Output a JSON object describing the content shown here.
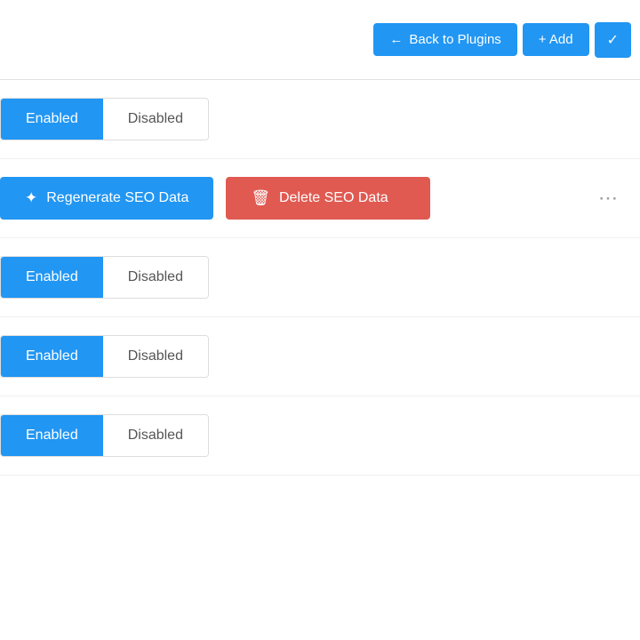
{
  "header": {
    "back_button_label": "Back to Plugins",
    "add_button_label": "+ Add",
    "check_button_label": "✓",
    "back_arrow": "←",
    "plus": "+"
  },
  "actions": {
    "regenerate_label": "Regenerate SEO Data",
    "delete_label": "Delete SEO Data",
    "regenerate_icon": "✦",
    "delete_icon": "🗑"
  },
  "toggles": [
    {
      "id": "toggle-1",
      "enabled_label": "Enabled",
      "disabled_label": "Disabled",
      "active": "enabled"
    },
    {
      "id": "toggle-2",
      "enabled_label": "Enabled",
      "disabled_label": "Disabled",
      "active": "enabled"
    },
    {
      "id": "toggle-3",
      "enabled_label": "Enabled",
      "disabled_label": "Disabled",
      "active": "enabled"
    },
    {
      "id": "toggle-4",
      "enabled_label": "Enabled",
      "disabled_label": "Disabled",
      "active": "enabled"
    }
  ],
  "colors": {
    "blue": "#2196f3",
    "red": "#e05a52",
    "white": "#ffffff",
    "border": "#ddd"
  }
}
